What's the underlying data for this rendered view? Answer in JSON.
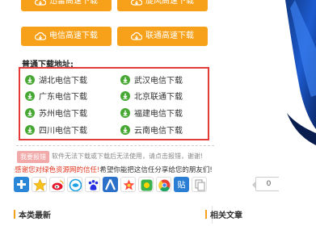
{
  "download_buttons": [
    {
      "label": "迅雷高速下载"
    },
    {
      "label": "旋风高速下载"
    },
    {
      "label": "电信高速下载"
    },
    {
      "label": "联通高速下载"
    }
  ],
  "section_title": "普通下载地址:",
  "download_links": [
    {
      "label": "湖北电信下载"
    },
    {
      "label": "武汉电信下载"
    },
    {
      "label": "广东电信下载"
    },
    {
      "label": "北京联通下载"
    },
    {
      "label": "苏州电信下载"
    },
    {
      "label": "福建电信下载"
    },
    {
      "label": "四川电信下载"
    },
    {
      "label": "云南电信下载"
    }
  ],
  "report": {
    "button_label": "我要报错",
    "note": "软件无法下载或下载后无法使用，请点击报错，谢谢!"
  },
  "thanks": {
    "red_text": "感谢您对绿色资源网的信任!",
    "dark_text": "希望你能把这信任分享给您的朋友们!"
  },
  "share": {
    "count": "0",
    "icons": [
      "plus-icon",
      "star-icon",
      "weibo-icon",
      "qq-zone-icon",
      "people-icon",
      "baidu-icon",
      "star-badge-icon",
      "douban-icon",
      "chrome-icon",
      "tieba-icon",
      "copy-icon"
    ],
    "tieba_label": "贴"
  },
  "bottom": {
    "recent_label": "本类最新",
    "related_label": "相关文章"
  },
  "colors": {
    "orange": "#f7a11a",
    "green": "#46a832",
    "red_border": "#e53a3a",
    "red_text": "#e0341e"
  }
}
